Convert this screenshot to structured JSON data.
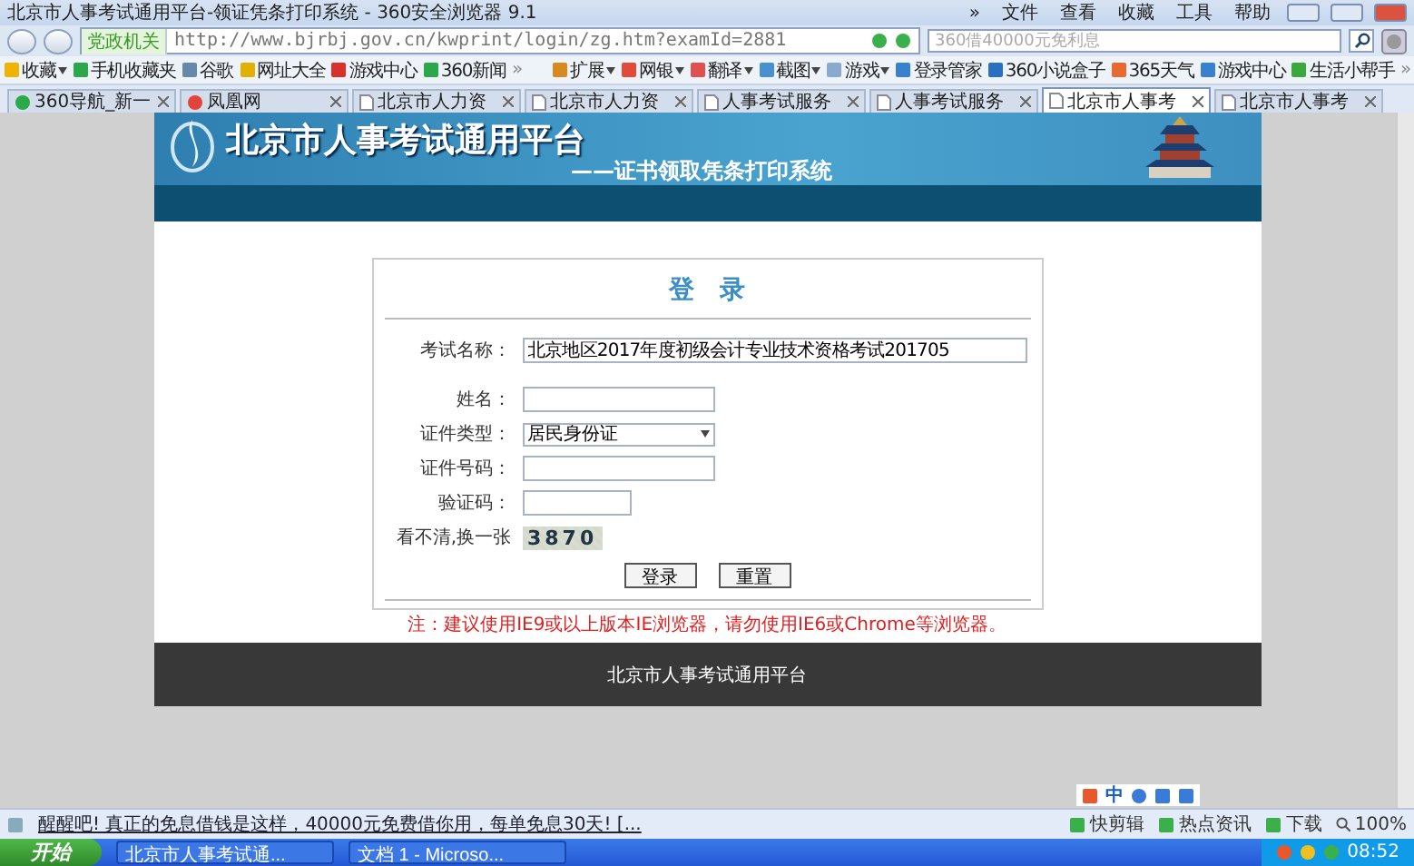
{
  "window": {
    "title": "北京市人事考试通用平台-领证凭条打印系统 - 360安全浏览器 9.1",
    "menu": [
      "»",
      "文件",
      "查看",
      "收藏",
      "工具",
      "帮助"
    ]
  },
  "address": {
    "badge": "党政机关",
    "url": "http://www.bjrbj.gov.cn/kwprint/login/zg.htm?examId=2881",
    "search_placeholder": "360借40000元免利息"
  },
  "bookmarks": [
    {
      "label": "收藏",
      "kind": "menu"
    },
    {
      "label": "手机收藏夹",
      "kind": "link"
    },
    {
      "label": "谷歌",
      "kind": "link"
    },
    {
      "label": "网址大全",
      "kind": "link"
    },
    {
      "label": "游戏中心",
      "kind": "link"
    },
    {
      "label": "360新闻",
      "kind": "link"
    },
    {
      "label": "»",
      "kind": "more"
    },
    {
      "label": "扩展",
      "kind": "menu"
    },
    {
      "label": "网银",
      "kind": "menu"
    },
    {
      "label": "翻译",
      "kind": "menu"
    },
    {
      "label": "截图",
      "kind": "menu"
    },
    {
      "label": "游戏",
      "kind": "menu"
    },
    {
      "label": "登录管家",
      "kind": "link"
    },
    {
      "label": "360小说盒子",
      "kind": "link"
    },
    {
      "label": "365天气",
      "kind": "link"
    },
    {
      "label": "游戏中心",
      "kind": "link"
    },
    {
      "label": "生活小帮手",
      "kind": "link"
    },
    {
      "label": "»",
      "kind": "more"
    }
  ],
  "tabs": [
    {
      "label": "360导航_新一",
      "selected": false
    },
    {
      "label": "凤凰网",
      "selected": false
    },
    {
      "label": "北京市人力资",
      "selected": false
    },
    {
      "label": "北京市人力资",
      "selected": false
    },
    {
      "label": "人事考试服务",
      "selected": false
    },
    {
      "label": "人事考试服务",
      "selected": false
    },
    {
      "label": "北京市人事考",
      "selected": true
    },
    {
      "label": "北京市人事考",
      "selected": false
    }
  ],
  "page": {
    "header": {
      "title": "北京市人事考试通用平台",
      "subtitle": "——证书领取凭条打印系统"
    },
    "login": {
      "title": "登　录",
      "fields": [
        {
          "label": "考试名称：",
          "kind": "text",
          "value": "北京地区2017年度初级会计专业技术资格考试201705"
        },
        {
          "label": "姓名：",
          "kind": "text"
        },
        {
          "label": "证件类型：",
          "kind": "select",
          "value": "居民身份证"
        },
        {
          "label": "证件号码：",
          "kind": "text"
        },
        {
          "label": "验证码：",
          "kind": "short"
        }
      ],
      "captcha_hint": "看不清,换一张",
      "captcha": "3870",
      "buttons": [
        "登录",
        "重置"
      ],
      "notice": "注：建议使用IE9或以上版本IE浏览器，请勿使用IE6或Chrome等浏览器。"
    },
    "footer": "北京市人事考试通用平台"
  },
  "ime": {
    "label": "中"
  },
  "status_bar": {
    "message": "醒醒吧! 真正的免息借钱是这样，40000元免费借你用，每单免息30天! [...",
    "items": [
      "快剪辑",
      "热点资讯",
      "下载"
    ],
    "zoom": "100%"
  },
  "taskbar": {
    "start": "开始",
    "tasks": [
      "北京市人事考试通...",
      "文档 1 - Microso..."
    ],
    "clock": "08:52"
  }
}
